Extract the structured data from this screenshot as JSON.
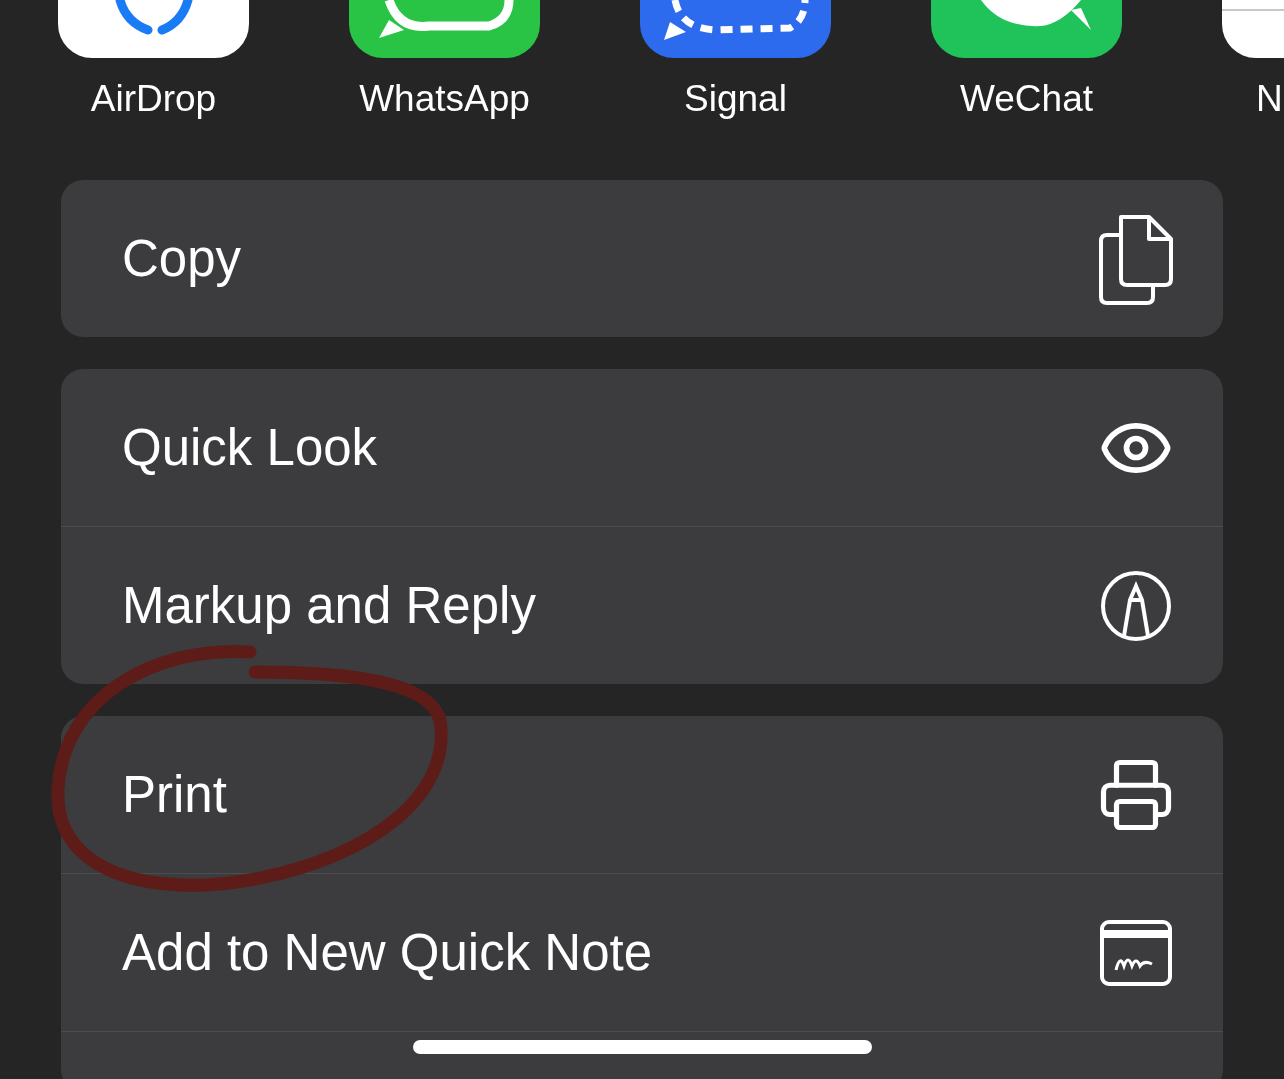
{
  "apps": [
    {
      "label": "AirDrop",
      "kind": "airdrop"
    },
    {
      "label": "WhatsApp",
      "kind": "whatsapp"
    },
    {
      "label": "Signal",
      "kind": "signal"
    },
    {
      "label": "WeChat",
      "kind": "wechat"
    },
    {
      "label": "N",
      "kind": "notes"
    }
  ],
  "action_groups": [
    [
      {
        "label": "Copy"
      }
    ],
    [
      {
        "label": "Quick Look"
      },
      {
        "label": "Markup and Reply"
      }
    ],
    [
      {
        "label": "Print"
      },
      {
        "label": "Add to New Quick Note"
      }
    ]
  ],
  "annotations": [
    {
      "kind": "circle"
    }
  ]
}
